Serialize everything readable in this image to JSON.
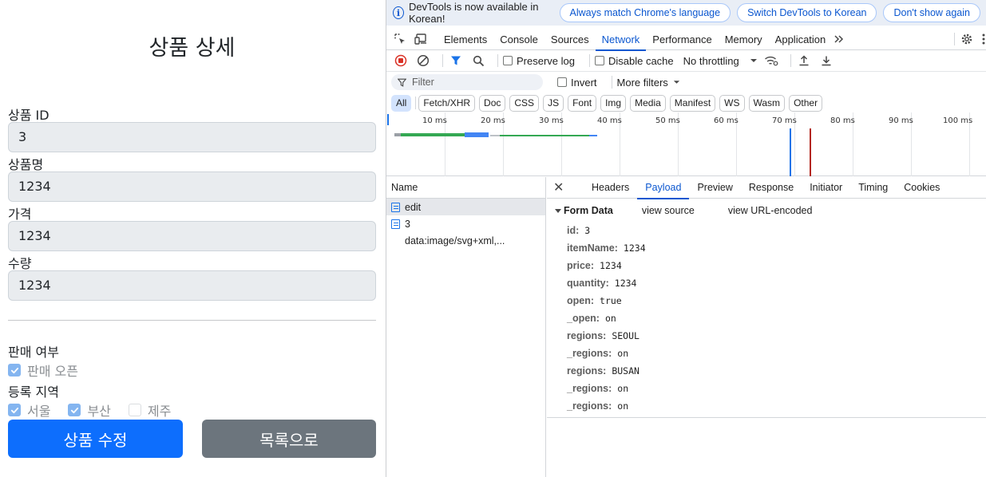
{
  "page": {
    "title": "상품 상세",
    "fields": [
      {
        "label": "상품 ID",
        "value": "3"
      },
      {
        "label": "상품명",
        "value": "1234"
      },
      {
        "label": "가격",
        "value": "1234"
      },
      {
        "label": "수량",
        "value": "1234"
      }
    ],
    "sale_label": "판매 여부",
    "sale_checkbox": {
      "label": "판매 오픈",
      "checked": true
    },
    "region_label": "등록 지역",
    "regions": [
      {
        "label": "서울",
        "checked": true
      },
      {
        "label": "부산",
        "checked": true
      },
      {
        "label": "제주",
        "checked": false
      }
    ],
    "edit_button": "상품 수정",
    "list_button": "목록으로",
    "colors": {
      "primary": "#0d6efd",
      "secondary": "#6c757d",
      "input_bg": "#e9ecef"
    }
  },
  "devtools": {
    "infobar": {
      "text": "DevTools is now available in Korean!",
      "buttons": [
        "Always match Chrome's language",
        "Switch DevTools to Korean",
        "Don't show again"
      ]
    },
    "tabs": [
      "Elements",
      "Console",
      "Sources",
      "Network",
      "Performance",
      "Memory",
      "Application"
    ],
    "active_tab": "Network",
    "toolbar": {
      "preserve_log": "Preserve log",
      "disable_cache": "Disable cache",
      "throttling": "No throttling"
    },
    "filter": {
      "placeholder": "Filter",
      "invert": "Invert",
      "more_filters": "More filters"
    },
    "types": [
      "All",
      "Fetch/XHR",
      "Doc",
      "CSS",
      "JS",
      "Font",
      "Img",
      "Media",
      "Manifest",
      "WS",
      "Wasm",
      "Other"
    ],
    "timeline_ticks": [
      "10 ms",
      "20 ms",
      "30 ms",
      "40 ms",
      "50 ms",
      "60 ms",
      "70 ms",
      "80 ms",
      "90 ms",
      "100 ms"
    ],
    "name_header": "Name",
    "requests": [
      {
        "name": "edit",
        "selected": true,
        "icon": "document-icon"
      },
      {
        "name": "3",
        "selected": false,
        "icon": "document-icon"
      },
      {
        "name": "data:image/svg+xml,...",
        "selected": false,
        "icon": ""
      }
    ],
    "detail_tabs": [
      "Headers",
      "Payload",
      "Preview",
      "Response",
      "Initiator",
      "Timing",
      "Cookies"
    ],
    "active_detail_tab": "Payload",
    "form_data": {
      "title": "Form Data",
      "view_source": "view source",
      "view_url_encoded": "view URL-encoded",
      "rows": [
        {
          "key": "id:",
          "value": "3"
        },
        {
          "key": "itemName:",
          "value": "1234"
        },
        {
          "key": "price:",
          "value": "1234"
        },
        {
          "key": "quantity:",
          "value": "1234"
        },
        {
          "key": "open:",
          "value": "true"
        },
        {
          "key": "_open:",
          "value": "on"
        },
        {
          "key": "regions:",
          "value": "SEOUL"
        },
        {
          "key": "_regions:",
          "value": "on"
        },
        {
          "key": "regions:",
          "value": "BUSAN"
        },
        {
          "key": "_regions:",
          "value": "on"
        },
        {
          "key": "_regions:",
          "value": "on"
        }
      ]
    },
    "colors": {
      "accent": "#0b57d0",
      "infobar_bg": "#e9eef6",
      "selected_row": "#e5e7eb"
    }
  }
}
